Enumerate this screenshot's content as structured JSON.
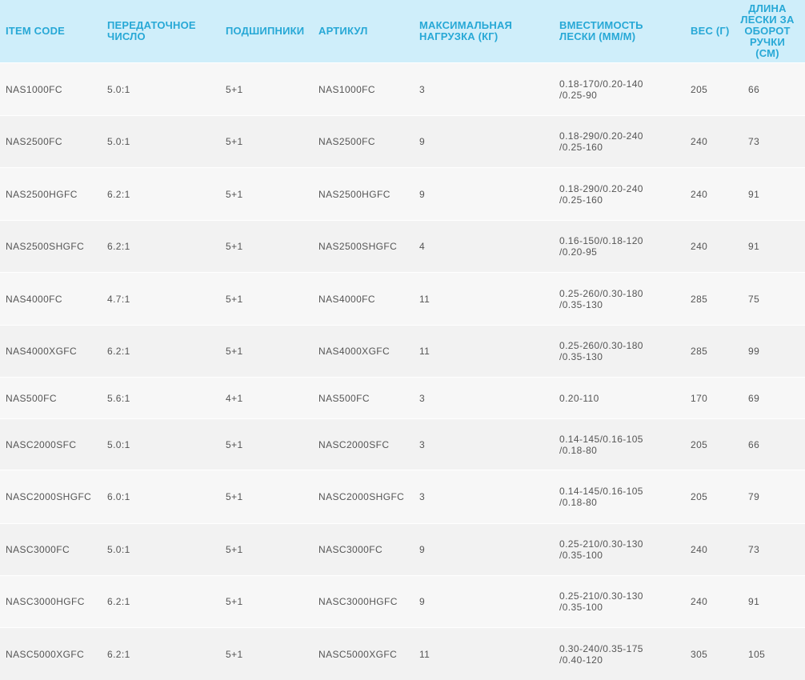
{
  "table": {
    "headers": [
      "ITEM CODE",
      "ПЕРЕДАТОЧНОЕ\nЧИСЛО",
      "ПОДШИПНИКИ",
      "АРТИКУЛ",
      "МАКСИМАЛЬНАЯ\nНАГРУЗКА (КГ)",
      "ВМЕСТИМОСТЬ\nЛЕСКИ (ММ/М)",
      "ВЕС (Г)",
      "ДЛИНА\nЛЕСКИ ЗА\nОБОРОТ\nРУЧКИ\n(СМ)"
    ],
    "rows": [
      [
        "NAS1000FC",
        "5.0:1",
        "5+1",
        "NAS1000FC",
        "3",
        "0.18-170/0.20-140\n/0.25-90",
        "205",
        "66"
      ],
      [
        "NAS2500FC",
        "5.0:1",
        "5+1",
        "NAS2500FC",
        "9",
        "0.18-290/0.20-240\n/0.25-160",
        "240",
        "73"
      ],
      [
        "NAS2500HGFC",
        "6.2:1",
        "5+1",
        "NAS2500HGFC",
        "9",
        "0.18-290/0.20-240\n/0.25-160",
        "240",
        "91"
      ],
      [
        "NAS2500SHGFC",
        "6.2:1",
        "5+1",
        "NAS2500SHGFC",
        "4",
        "0.16-150/0.18-120\n/0.20-95",
        "240",
        "91"
      ],
      [
        "NAS4000FC",
        "4.7:1",
        "5+1",
        "NAS4000FC",
        "11",
        "0.25-260/0.30-180\n/0.35-130",
        "285",
        "75"
      ],
      [
        "NAS4000XGFC",
        "6.2:1",
        "5+1",
        "NAS4000XGFC",
        "11",
        "0.25-260/0.30-180\n/0.35-130",
        "285",
        "99"
      ],
      [
        "NAS500FC",
        "5.6:1",
        "4+1",
        "NAS500FC",
        "3",
        "0.20-110",
        "170",
        "69"
      ],
      [
        "NASC2000SFC",
        "5.0:1",
        "5+1",
        "NASC2000SFC",
        "3",
        "0.14-145/0.16-105\n/0.18-80",
        "205",
        "66"
      ],
      [
        "NASC2000SHGFC",
        "6.0:1",
        "5+1",
        "NASC2000SHGFC",
        "3",
        "0.14-145/0.16-105\n/0.18-80",
        "205",
        "79"
      ],
      [
        "NASC3000FC",
        "5.0:1",
        "5+1",
        "NASC3000FC",
        "9",
        "0.25-210/0.30-130\n/0.35-100",
        "240",
        "73"
      ],
      [
        "NASC3000HGFC",
        "6.2:1",
        "5+1",
        "NASC3000HGFC",
        "9",
        "0.25-210/0.30-130\n/0.35-100",
        "240",
        "91"
      ],
      [
        "NASC5000XGFC",
        "6.2:1",
        "5+1",
        "NASC5000XGFC",
        "11",
        "0.30-240/0.35-175\n/0.40-120",
        "305",
        "105"
      ]
    ]
  }
}
